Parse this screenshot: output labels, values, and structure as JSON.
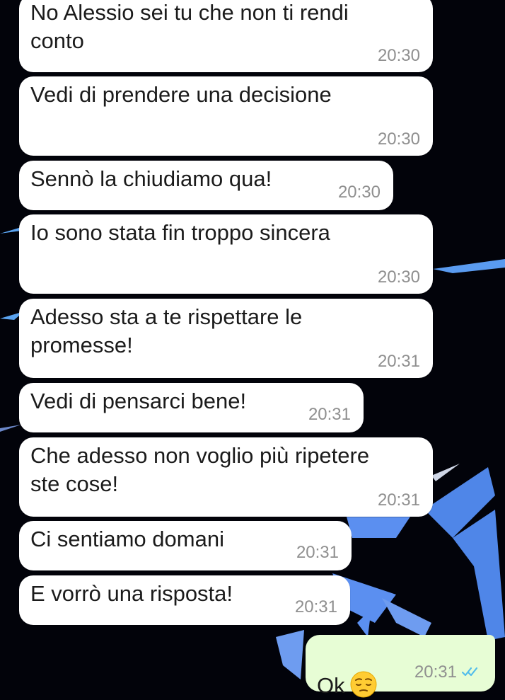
{
  "theme": {
    "incoming_bubble": "#ffffff",
    "outgoing_bubble": "#e7fdd5",
    "timestamp_color": "#8f8f8f",
    "read_ticks_color": "#53bdeb",
    "wallpaper_background": "#02030a",
    "wallpaper_accent": "#4f86e8"
  },
  "chat": {
    "messages": [
      {
        "direction": "incoming",
        "text": "No Alessio sei tu che non ti rendi\nconto",
        "time": "20:30"
      },
      {
        "direction": "incoming",
        "text": "Vedi di prendere una decisione",
        "time": "20:30"
      },
      {
        "direction": "incoming",
        "text": "Sennò la chiudiamo qua!",
        "time": "20:30"
      },
      {
        "direction": "incoming",
        "text": "Io sono stata fin troppo sincera",
        "time": "20:30"
      },
      {
        "direction": "incoming",
        "text": "Adesso sta a te rispettare le\npromesse!",
        "time": "20:31"
      },
      {
        "direction": "incoming",
        "text": "Vedi di pensarci bene!",
        "time": "20:31"
      },
      {
        "direction": "incoming",
        "text": "Che adesso non voglio più ripetere\nste cose!",
        "time": "20:31"
      },
      {
        "direction": "incoming",
        "text": "Ci sentiamo domani",
        "time": "20:31"
      },
      {
        "direction": "incoming",
        "text": "E vorrò una risposta!",
        "time": "20:31"
      },
      {
        "direction": "outgoing",
        "text": "Ok",
        "emoji": "pensive-face",
        "time": "20:31",
        "status": "read"
      }
    ]
  }
}
